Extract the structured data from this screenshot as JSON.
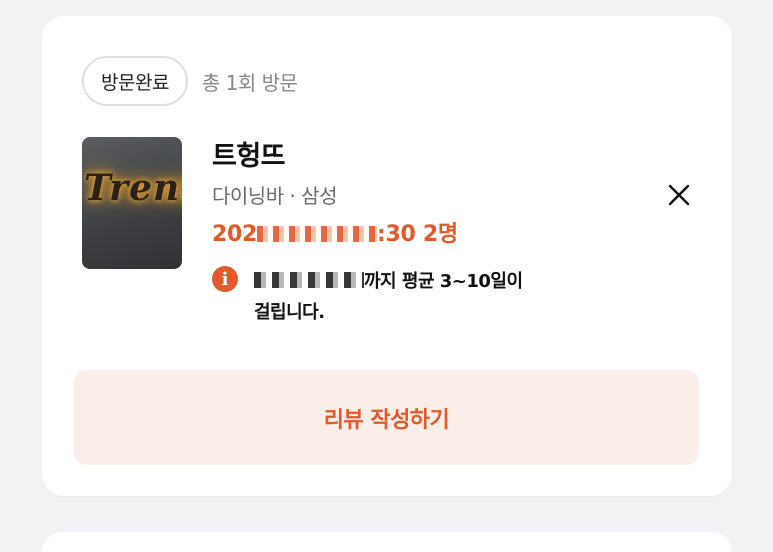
{
  "visit": {
    "status_label": "방문완료",
    "visit_count": "총 1회 방문"
  },
  "restaurant": {
    "thumbnail_text": "Trente",
    "name": "트헝뜨",
    "category": "다이닝바 · 삼성",
    "reservation_prefix": "202",
    "reservation_suffix": ":30 2명"
  },
  "notice": {
    "icon": "info-icon",
    "text_line1": "까지 평균 3~10일이",
    "text_line2": "걸립니다."
  },
  "actions": {
    "close_icon": "close-icon",
    "write_review_label": "리뷰 작성하기"
  },
  "colors": {
    "accent": "#e05a2a",
    "accent_bg": "#fbede7",
    "card_bg": "#ffffff",
    "page_bg": "#f2f2f4"
  }
}
